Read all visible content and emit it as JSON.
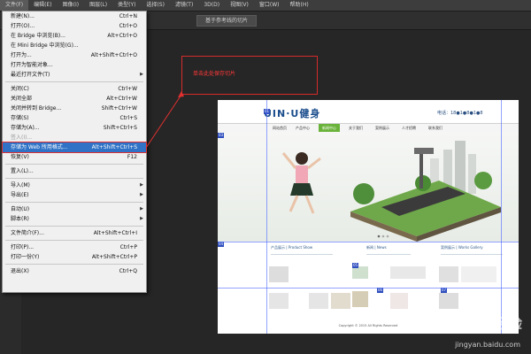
{
  "menubar": {
    "items": [
      "文件(F)",
      "编辑(E)",
      "图像(I)",
      "图层(L)",
      "类型(Y)",
      "选择(S)",
      "滤镜(T)",
      "3D(D)",
      "视图(V)",
      "窗口(W)",
      "帮助(H)"
    ]
  },
  "options_bar": {
    "button_label": "基于参考线的切片"
  },
  "file_menu": {
    "items": [
      {
        "label": "新建(N)...",
        "shortcut": "Ctrl+N"
      },
      {
        "label": "打开(O)...",
        "shortcut": "Ctrl+O"
      },
      {
        "label": "在 Bridge 中浏览(B)...",
        "shortcut": "Alt+Ctrl+O"
      },
      {
        "label": "在 Mini Bridge 中浏览(G)...",
        "shortcut": ""
      },
      {
        "label": "打开为...",
        "shortcut": "Alt+Shift+Ctrl+O"
      },
      {
        "label": "打开为智能对象...",
        "shortcut": ""
      },
      {
        "label": "最近打开文件(T)",
        "shortcut": ""
      },
      {
        "label": "关闭(C)",
        "shortcut": "Ctrl+W"
      },
      {
        "label": "关闭全部",
        "shortcut": "Alt+Ctrl+W"
      },
      {
        "label": "关闭并转到 Bridge...",
        "shortcut": "Shift+Ctrl+W"
      },
      {
        "label": "存储(S)",
        "shortcut": "Ctrl+S"
      },
      {
        "label": "存储为(A)...",
        "shortcut": "Shift+Ctrl+S"
      },
      {
        "label": "签入(I)...",
        "shortcut": ""
      },
      {
        "label": "存储为 Web 所用格式...",
        "shortcut": "Alt+Shift+Ctrl+S"
      },
      {
        "label": "恢复(V)",
        "shortcut": "F12"
      },
      {
        "label": "置入(L)...",
        "shortcut": ""
      },
      {
        "label": "导入(M)",
        "shortcut": ""
      },
      {
        "label": "导出(E)",
        "shortcut": ""
      },
      {
        "label": "自动(U)",
        "shortcut": ""
      },
      {
        "label": "脚本(R)",
        "shortcut": ""
      },
      {
        "label": "文件简介(F)...",
        "shortcut": "Alt+Shift+Ctrl+I"
      },
      {
        "label": "打印(P)...",
        "shortcut": "Ctrl+P"
      },
      {
        "label": "打印一份(Y)",
        "shortcut": "Alt+Shift+Ctrl+P"
      },
      {
        "label": "退出(X)",
        "shortcut": "Ctrl+Q"
      }
    ]
  },
  "callout": {
    "text": "单击此处保存切片"
  },
  "canvas": {
    "logo": "UIN∙U健身",
    "phone": "电话：18●1●8●1●8",
    "nav": [
      "网站首页",
      "产品中心",
      "新闻中心",
      "关于我们",
      "案例展示",
      "人才招聘",
      "联系我们"
    ],
    "sections": [
      "产品展示 | Product Show",
      "新闻 | News",
      "案例展示 | Works Gallery"
    ],
    "footer": "Copyright © 2015 All Rights Reserved"
  },
  "watermark": {
    "brand": "Bai 经验",
    "url": "jingyan.baidu.com"
  },
  "colors": {
    "highlight": "#2f72c6",
    "annotation_red": "#e03030",
    "nav_active": "#6ab33a",
    "slice_badge": "#2f4fbf"
  }
}
